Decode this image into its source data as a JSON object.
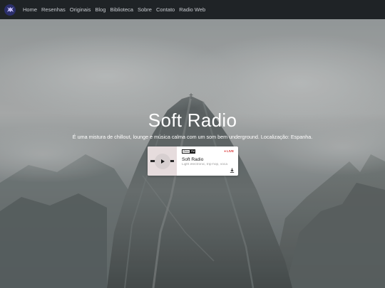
{
  "nav": {
    "logo_icon": "soft-radio-logo",
    "links": [
      "Home",
      "Resenhas",
      "Originais",
      "Blog",
      "Biblioteca",
      "Sobre",
      "Contato",
      "Radio Web"
    ]
  },
  "hero": {
    "title": "Soft Radio",
    "subtitle": "É uma mistura de chillout, lounge e música calma com um som bem underground. Localização: Espanha."
  },
  "player": {
    "badge_left": "Zeno",
    "badge_right": "FM",
    "live_label": "LIVE",
    "station_name": "Soft Radio",
    "station_description": "Light electronic, trip-hop, voca",
    "play_icon": "play-icon",
    "download_icon": "download-icon"
  },
  "colors": {
    "navbar": "#1f2326",
    "nav_text": "#c9ccd1",
    "live": "#d93a3a",
    "logo_bg": "#2b2f6b"
  }
}
